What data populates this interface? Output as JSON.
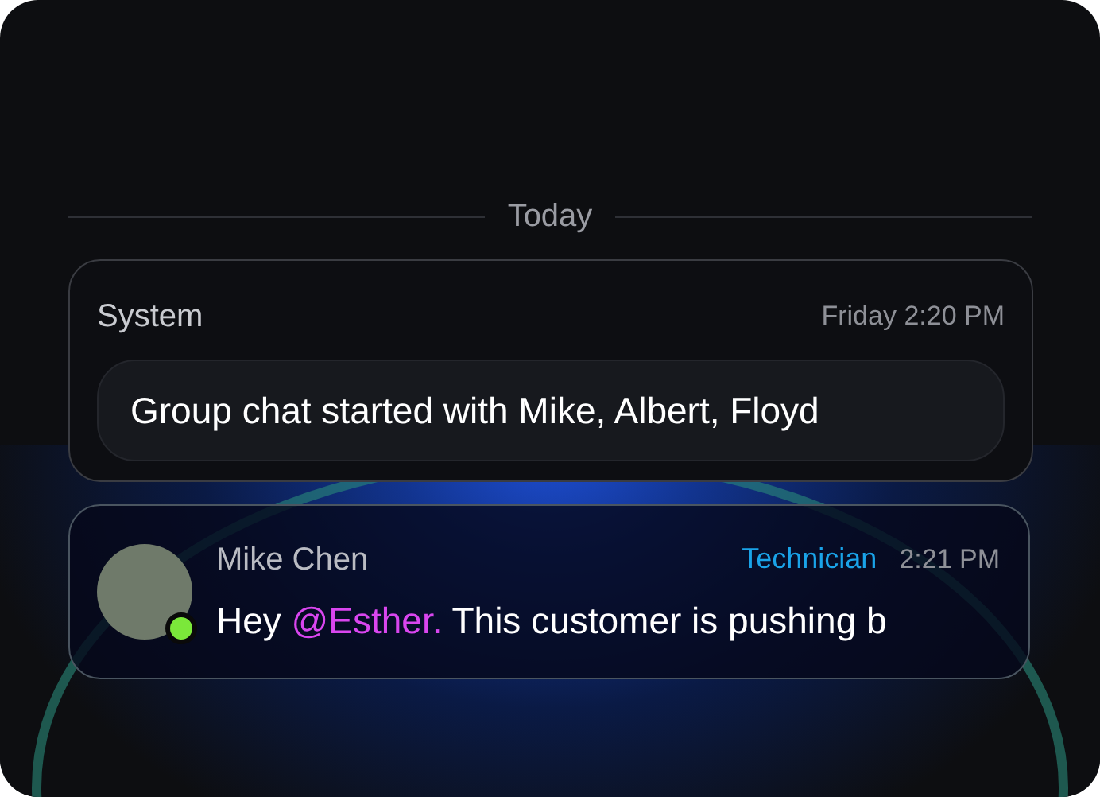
{
  "date_divider": "Today",
  "messages": [
    {
      "kind": "system",
      "sender": "System",
      "time": "Friday 2:20 PM",
      "text": "Group chat started with Mike, Albert, Floyd"
    },
    {
      "kind": "user",
      "sender": "Mike Chen",
      "role": "Technician",
      "time": "2:21 PM",
      "online": true,
      "parts": [
        {
          "kind": "text",
          "text": "Hey "
        },
        {
          "kind": "mention",
          "text": "@Esther."
        },
        {
          "kind": "text",
          "text": " This customer is pushing b"
        }
      ]
    }
  ]
}
